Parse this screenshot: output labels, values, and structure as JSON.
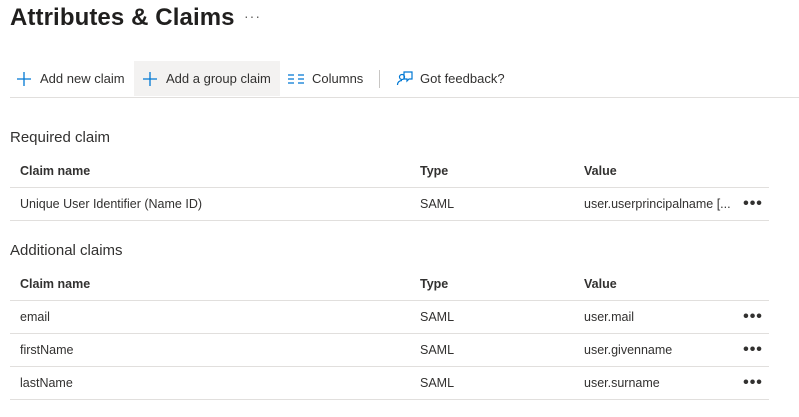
{
  "header": {
    "title": "Attributes & Claims",
    "more": "···"
  },
  "toolbar": {
    "add_new_claim": "Add new claim",
    "add_group_claim": "Add a group claim",
    "columns": "Columns",
    "feedback": "Got feedback?"
  },
  "required": {
    "title": "Required claim",
    "columns": [
      "Claim name",
      "Type",
      "Value"
    ],
    "rows": [
      {
        "name": "Unique User Identifier (Name ID)",
        "type": "SAML",
        "value": "user.userprincipalname [..."
      }
    ]
  },
  "additional": {
    "title": "Additional claims",
    "columns": [
      "Claim name",
      "Type",
      "Value"
    ],
    "rows": [
      {
        "name": "email",
        "type": "SAML",
        "value": "user.mail"
      },
      {
        "name": "firstName",
        "type": "SAML",
        "value": "user.givenname"
      },
      {
        "name": "lastName",
        "type": "SAML",
        "value": "user.surname"
      }
    ]
  },
  "row_more": "•••",
  "icons": {
    "add_new_claim": "plus-icon",
    "add_group_claim": "plus-icon",
    "columns": "columns-icon",
    "feedback": "feedback-icon"
  },
  "colors": {
    "accent": "#0078d4",
    "divider": "#e1dfdd",
    "hover": "#f3f2f1"
  }
}
